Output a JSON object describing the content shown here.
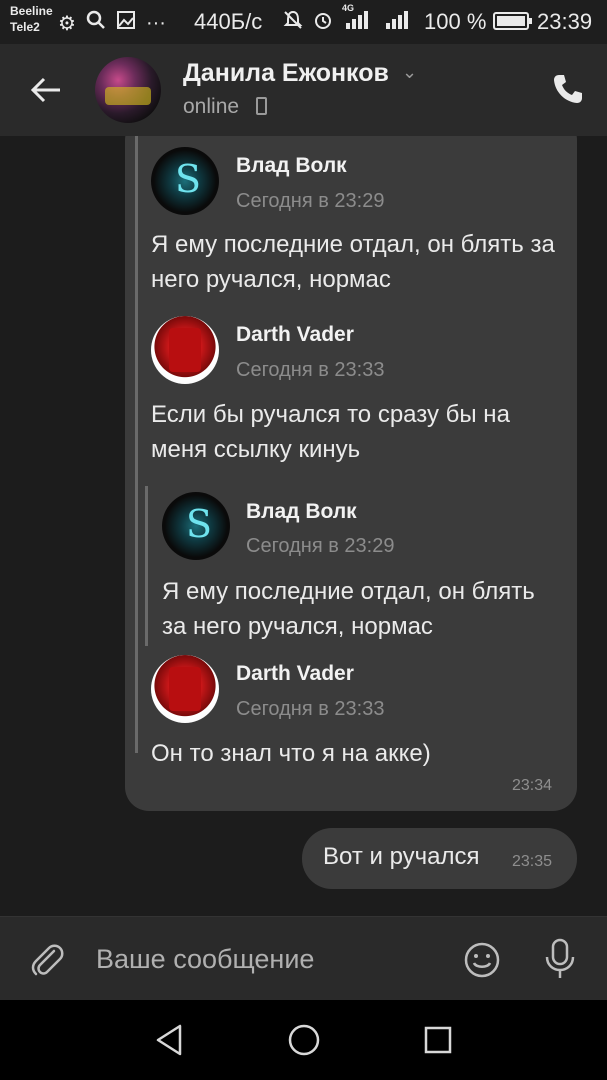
{
  "status_bar": {
    "carrier1": "Beeline",
    "carrier2": "Tele2",
    "speed": "440Б/с",
    "network": "4G",
    "battery": "100 %",
    "battery_level": 1.0,
    "time": "23:39",
    "icons": [
      "lion-icon",
      "search-icon",
      "gallery-icon",
      "more-icon",
      "mute-icon",
      "alarm-icon",
      "signal-icon",
      "signal-icon",
      "battery-icon"
    ]
  },
  "header": {
    "contact_name": "Данила Ежонков",
    "status": "online",
    "back_icon": "arrow-left-icon",
    "call_icon": "phone-icon"
  },
  "chat": {
    "incoming": {
      "forwarded": [
        {
          "author": "Влад Волк",
          "date": "Сегодня в 23:29",
          "text": "Я ему последние отдал, он блять за него ручался, нормас"
        },
        {
          "author": "Darth Vader",
          "date": "Сегодня в 23:33",
          "text": "Если бы ручался то сразу бы на меня ссылку кинуь"
        },
        {
          "author": "Влад Волк",
          "date": "Сегодня в 23:29",
          "text": "Я ему последние отдал, он блять за него ручался, нормас"
        },
        {
          "author": "Darth Vader",
          "date": "Сегодня в 23:33",
          "text": "Он то знал что я на акке)"
        }
      ],
      "time": "23:34"
    },
    "outgoing": {
      "text": "Вот и ручался",
      "time": "23:35"
    }
  },
  "input": {
    "placeholder": "Ваше сообщение"
  },
  "nav": {
    "back": "triangle-back-icon",
    "home": "circle-home-icon",
    "recents": "square-recents-icon"
  }
}
